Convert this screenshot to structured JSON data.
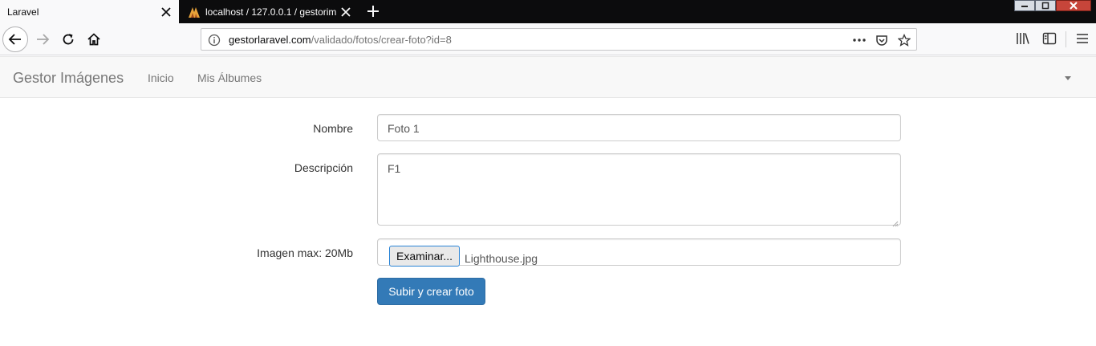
{
  "browser": {
    "tabs": [
      {
        "title": "Laravel",
        "active": true
      },
      {
        "title": "localhost / 127.0.0.1 / gestorim",
        "active": false
      }
    ],
    "url": {
      "host": "gestorlaravel.com",
      "path": "/validado/fotos/crear-foto?id=8"
    }
  },
  "navbar": {
    "brand": "Gestor Imágenes",
    "links": [
      "Inicio",
      "Mis Álbumes"
    ]
  },
  "form": {
    "nombre": {
      "label": "Nombre",
      "value": "Foto 1"
    },
    "descripcion": {
      "label": "Descripción",
      "value": "F1"
    },
    "imagen": {
      "label": "Imagen max: 20Mb",
      "button": "Examinar...",
      "filename": "Lighthouse.jpg"
    },
    "submit": "Subir y crear foto"
  },
  "colors": {
    "primary": "#337ab7",
    "navbar_bg": "#f8f8f8",
    "tabbar_bg": "#0c0c0d"
  }
}
